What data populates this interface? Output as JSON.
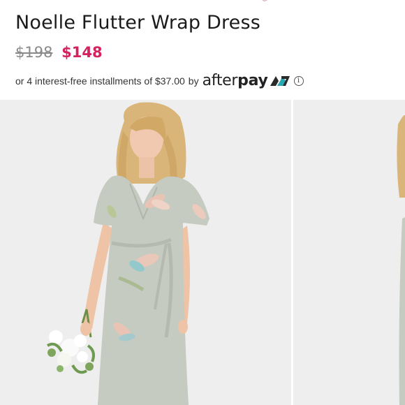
{
  "product": {
    "title": "Noelle Flutter Wrap Dress",
    "price_original": "$198",
    "price_sale": "$148"
  },
  "installments": {
    "text": "or 4 interest-free installments of $37.00",
    "by": "by",
    "provider_after": "after",
    "provider_pay": "pay"
  },
  "colors": {
    "sale_price": "#d5225e",
    "original_price": "#8a8a8a",
    "afterpay_mark_teal": "#2aa6b5",
    "photo_background": "#eeeeee",
    "dress": "#c5cbc0"
  },
  "icons": [
    "afterpay-logo-icon",
    "info-icon",
    "top-mark-icon"
  ],
  "gallery": {
    "images": [
      {
        "name": "model-front-view"
      },
      {
        "name": "model-partial-view"
      }
    ]
  }
}
